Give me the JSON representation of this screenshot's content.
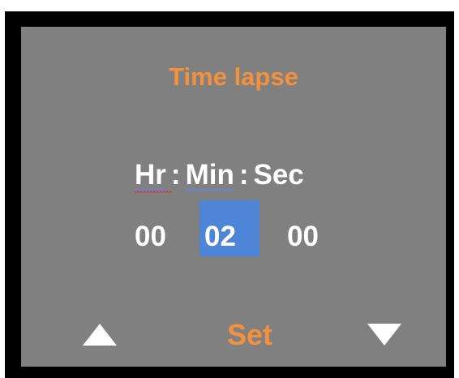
{
  "screen": {
    "title": "Time lapse",
    "units": {
      "hr": "Hr",
      "min": "Min",
      "sec": "Sec",
      "separator": ":"
    },
    "values": {
      "hr": "00",
      "min": "02",
      "sec": "00"
    },
    "selected_field": "min",
    "set_label": "Set",
    "icons": {
      "up": "up-triangle-icon",
      "down": "down-triangle-icon"
    },
    "colors": {
      "background": "#808080",
      "accent": "#f3913c",
      "selection": "#4f85d6",
      "text": "#ffffff",
      "frame": "#000000"
    }
  }
}
